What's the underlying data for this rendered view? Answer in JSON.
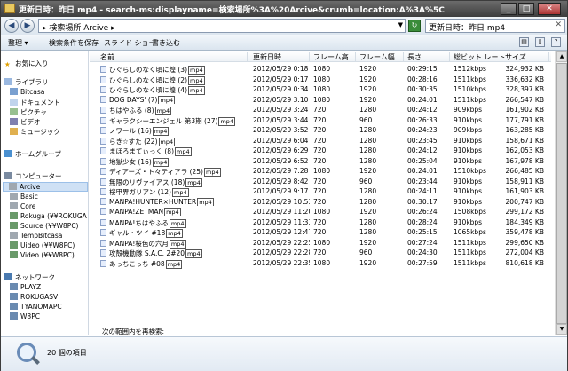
{
  "window": {
    "title": "更新日時：昨日 mp4 - search-ms:displayname=検索場所%3A%20Arcive&crumb=location:A%3A%5C"
  },
  "address": {
    "breadcrumb": "▸ 検索場所 Arcive ▸",
    "search_value": "更新日時：昨日 mp4"
  },
  "toolbar": {
    "organize": "整理 ▾",
    "save_search": "検索条件を保存",
    "slideshow": "スライド ショー",
    "burn": "書き込む"
  },
  "sidebar": {
    "favorites": "お気に入り",
    "library": "ライブラリ",
    "lib_items": [
      "Bitcasa",
      "ドキュメント",
      "ピクチャ",
      "ビデオ",
      "ミュージック"
    ],
    "homegroup": "ホームグループ",
    "computer": "コンピューター",
    "computer_items": [
      "Arcive",
      "Basic",
      "Core",
      "Rokuga (¥¥ROKUGA",
      "Source (¥¥W8PC)",
      "TempBitcasa",
      "Uideo (¥¥W8PC)",
      "Video (¥¥W8PC)"
    ],
    "network": "ネットワーク",
    "network_items": [
      "PLAYZ",
      "ROKUGASV",
      "TYANOMAPC",
      "W8PC"
    ]
  },
  "columns": [
    "名前",
    "更新日時",
    "フレーム高",
    "フレーム幅",
    "長さ",
    "総ビット レート",
    "サイズ"
  ],
  "files": [
    {
      "name": "ひぐらしのなく頃に煌 (3)",
      "date": "2012/05/29 0:18",
      "h": "1080",
      "w": "1920",
      "len": "00:29:15",
      "rate": "1512kbps",
      "size": "324,932 KB"
    },
    {
      "name": "ひぐらしのなく頃に煌 (2)",
      "date": "2012/05/29 0:17",
      "h": "1080",
      "w": "1920",
      "len": "00:28:16",
      "rate": "1511kbps",
      "size": "336,632 KB"
    },
    {
      "name": "ひぐらしのなく頃に煌 (4)",
      "date": "2012/05/29 0:34",
      "h": "1080",
      "w": "1920",
      "len": "00:30:35",
      "rate": "1510kbps",
      "size": "328,397 KB"
    },
    {
      "name": "DOG DAYS' (7)",
      "date": "2012/05/29 3:10",
      "h": "1080",
      "w": "1920",
      "len": "00:24:01",
      "rate": "1511kbps",
      "size": "266,547 KB"
    },
    {
      "name": "ちはやふる (8)",
      "date": "2012/05/29 3:24",
      "h": "720",
      "w": "1280",
      "len": "00:24:12",
      "rate": "909kbps",
      "size": "161,902 KB"
    },
    {
      "name": "ギャラクシーエンジェル 第3期 (27)",
      "date": "2012/05/29 3:44",
      "h": "720",
      "w": "960",
      "len": "00:26:33",
      "rate": "910kbps",
      "size": "177,791 KB"
    },
    {
      "name": "ノワール (16)",
      "date": "2012/05/29 3:52",
      "h": "720",
      "w": "1280",
      "len": "00:24:23",
      "rate": "909kbps",
      "size": "163,285 KB"
    },
    {
      "name": "らき☆すた (22)",
      "date": "2012/05/29 6:04",
      "h": "720",
      "w": "1280",
      "len": "00:23:45",
      "rate": "910kbps",
      "size": "158,671 KB"
    },
    {
      "name": "まほろまてぃっく (8)",
      "date": "2012/05/29 6:29",
      "h": "720",
      "w": "1280",
      "len": "00:24:12",
      "rate": "910kbps",
      "size": "162,053 KB"
    },
    {
      "name": "地獄少女 (16)",
      "date": "2012/05/29 6:52",
      "h": "720",
      "w": "1280",
      "len": "00:25:04",
      "rate": "910kbps",
      "size": "167,978 KB"
    },
    {
      "name": "ディアーズ・ト々ティアラ (25)",
      "date": "2012/05/29 7:28",
      "h": "1080",
      "w": "1920",
      "len": "00:24:01",
      "rate": "1510kbps",
      "size": "266,485 KB"
    },
    {
      "name": "無限のリヴァイアス (18)",
      "date": "2012/05/29 8:42",
      "h": "720",
      "w": "960",
      "len": "00:23:44",
      "rate": "910kbps",
      "size": "158,911 KB"
    },
    {
      "name": "桜甲界ガリアン (12)",
      "date": "2012/05/29 9:17",
      "h": "720",
      "w": "1280",
      "len": "00:24:11",
      "rate": "910kbps",
      "size": "161,903 KB"
    },
    {
      "name": "MANPA!HUNTER×HUNTER",
      "date": "2012/05/29 10:53",
      "h": "720",
      "w": "1280",
      "len": "00:30:17",
      "rate": "910kbps",
      "size": "200,747 KB"
    },
    {
      "name": "MANPA!ZETMAN",
      "date": "2012/05/29 11:20",
      "h": "1080",
      "w": "1920",
      "len": "00:26:24",
      "rate": "1508kbps",
      "size": "299,172 KB"
    },
    {
      "name": "MANPA!ちはやふる",
      "date": "2012/05/29 11:33",
      "h": "720",
      "w": "1280",
      "len": "00:28:24",
      "rate": "910kbps",
      "size": "184,349 KB"
    },
    {
      "name": "ギャル・ツイ #18",
      "date": "2012/05/29 12:47",
      "h": "720",
      "w": "1280",
      "len": "00:25:15",
      "rate": "1065kbps",
      "size": "359,478 KB"
    },
    {
      "name": "MANPA!桜色の六月",
      "date": "2012/05/29 22:25",
      "h": "1080",
      "w": "1920",
      "len": "00:27:24",
      "rate": "1511kbps",
      "size": "299,650 KB"
    },
    {
      "name": "攻殻機動隊 S.A.C. 2#20",
      "date": "2012/05/29 22:28",
      "h": "720",
      "w": "960",
      "len": "00:24:30",
      "rate": "1511kbps",
      "size": "272,004 KB"
    },
    {
      "name": "あっちこっち #08",
      "date": "2012/05/29 22:35",
      "h": "1080",
      "w": "1920",
      "len": "00:27:59",
      "rate": "1511kbps",
      "size": "810,618 KB"
    }
  ],
  "mp4_tag": "mp4",
  "search_again": "次の範囲内を再検索:",
  "status": {
    "item_count": "20 個の項目"
  }
}
